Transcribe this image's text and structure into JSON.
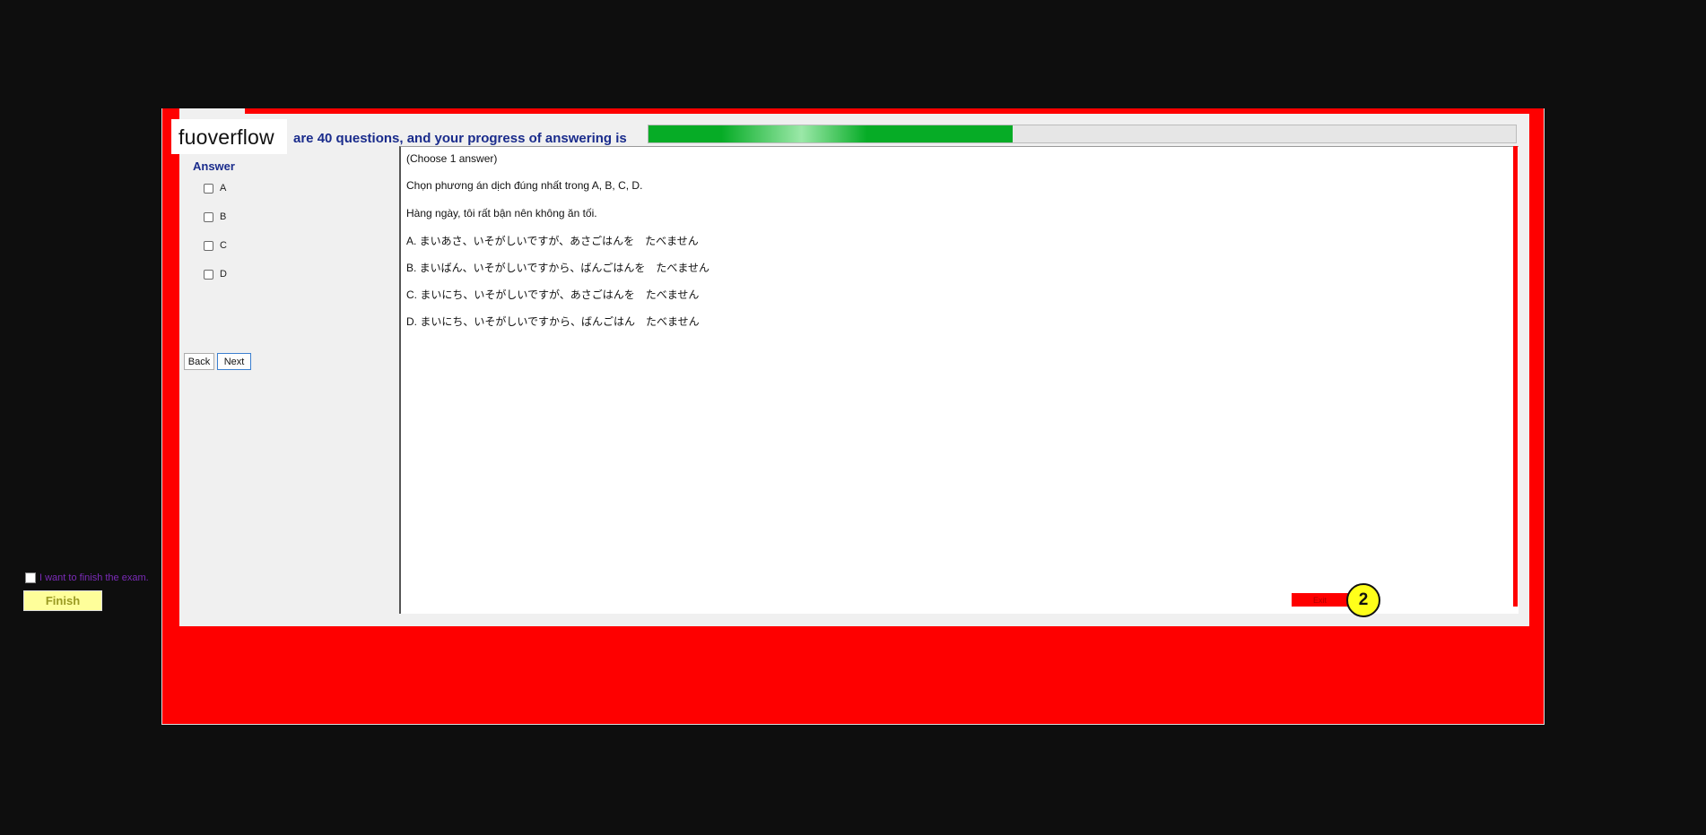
{
  "header": {
    "logo": "fuoverflow",
    "progress_text": "are 40 questions, and your progress of answering is",
    "progress_fraction": 0.42
  },
  "answer_panel": {
    "label": "Answer",
    "options": [
      "A",
      "B",
      "C",
      "D"
    ],
    "back_label": "Back",
    "next_label": "Next"
  },
  "question": {
    "lines": [
      "(Choose 1 answer)",
      "Chọn phương án dịch đúng nhất trong A, B, C, D.",
      "Hàng ngày, tôi rất bận nên không ăn tối.",
      "A. まいあさ、いそがしいですが、あさごはんを　たべません",
      "B. まいばん、いそがしいですから、ばんごはんを　たべません",
      "C. まいにち、いそがしいですが、あさごはんを　たべません",
      "D. まいにち、いそがしいですから、ばんごはん　たべません"
    ]
  },
  "footer": {
    "finish_checkbox_label": "I want to finish the exam.",
    "finish_label": "Finish",
    "exit_label": "Exit",
    "step_badge": "2"
  },
  "colors": {
    "window_red": "#fe0000",
    "progress_green": "#06ac26",
    "label_blue": "#1a2c8c",
    "finish_yellow": "#fefe9a",
    "badge_yellow": "#ffff1a"
  }
}
